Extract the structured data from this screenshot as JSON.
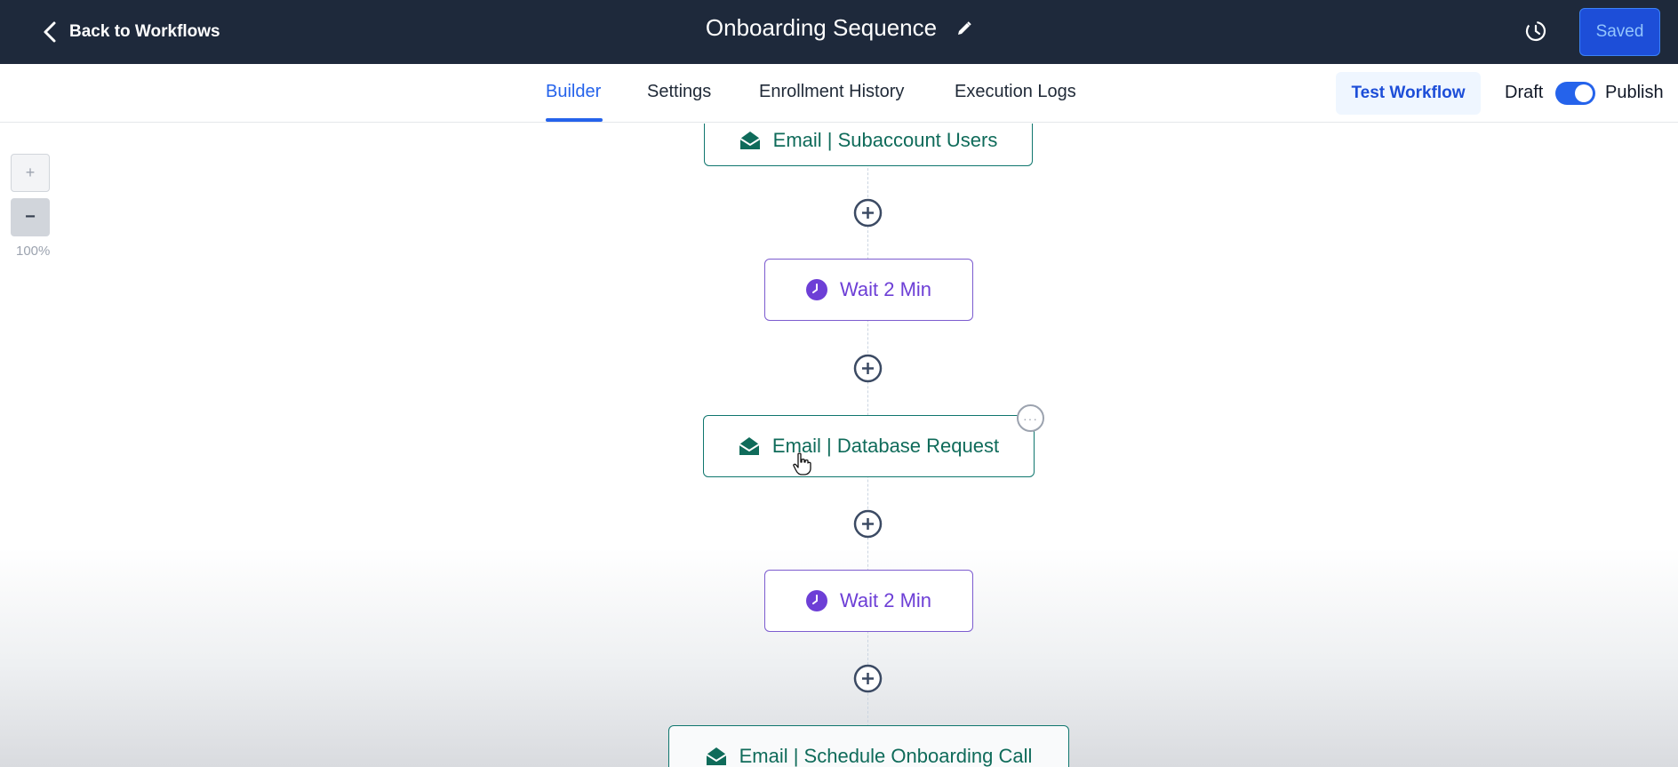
{
  "header": {
    "back_label": "Back to Workflows",
    "title": "Onboarding Sequence",
    "saved_label": "Saved"
  },
  "tabs": [
    {
      "label": "Builder",
      "active": true
    },
    {
      "label": "Settings",
      "active": false
    },
    {
      "label": "Enrollment History",
      "active": false
    },
    {
      "label": "Execution Logs",
      "active": false
    }
  ],
  "actions": {
    "test_label": "Test Workflow",
    "draft_label": "Draft",
    "publish_label": "Publish",
    "publish_on": true
  },
  "zoom": {
    "in_label": "+",
    "out_label": "−",
    "level": "100%"
  },
  "nodes": [
    {
      "type": "email",
      "label": "Email | Subaccount Users",
      "icon": "envelope-open-icon"
    },
    {
      "type": "wait",
      "label": "Wait 2 Min",
      "icon": "clock-icon"
    },
    {
      "type": "email",
      "label": "Email | Database Request",
      "icon": "envelope-open-icon"
    },
    {
      "type": "wait",
      "label": "Wait 2 Min",
      "icon": "clock-icon"
    },
    {
      "type": "email",
      "label": "Email | Schedule Onboarding Call",
      "icon": "envelope-open-icon"
    }
  ],
  "colors": {
    "header_bg": "#1e293b",
    "accent": "#2563eb",
    "email_node": "#0f766e",
    "wait_node": "#6d3fd6"
  }
}
